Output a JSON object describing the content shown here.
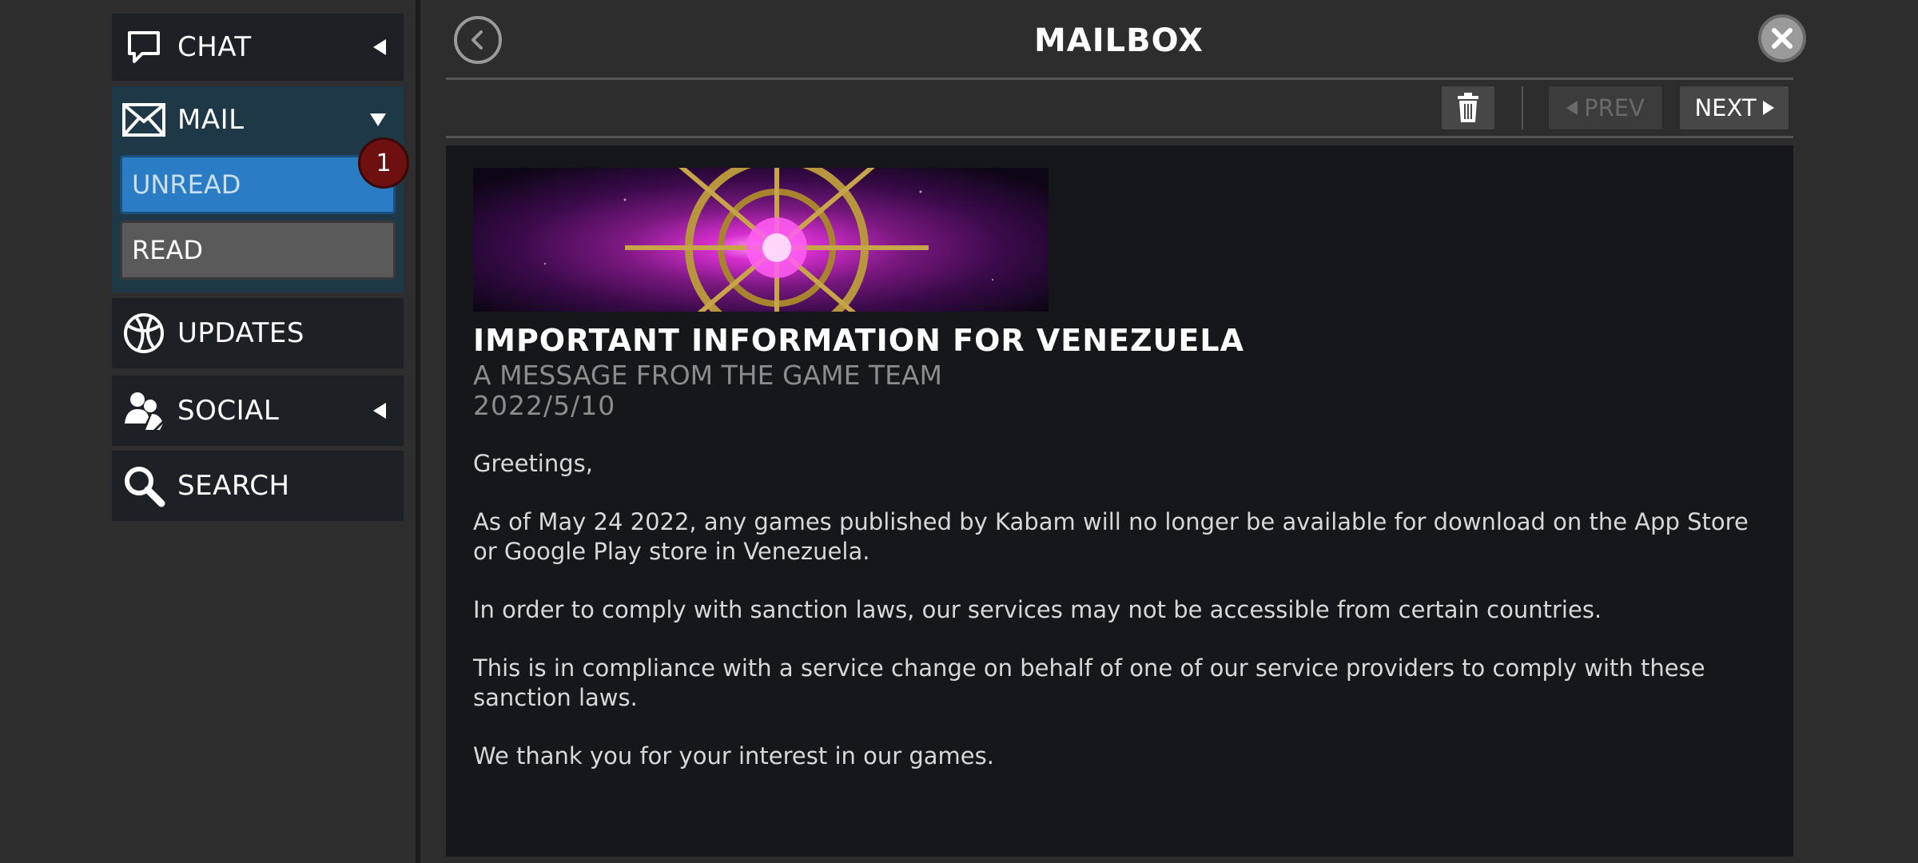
{
  "sidebar": {
    "chat_label": "CHAT",
    "mail_label": "MAIL",
    "unread_label": "UNREAD",
    "read_label": "READ",
    "unread_count": "1",
    "updates_label": "UPDATES",
    "social_label": "SOCIAL",
    "search_label": "SEARCH"
  },
  "header": {
    "title": "MAILBOX"
  },
  "toolbar": {
    "prev_label": "PREV",
    "next_label": "NEXT"
  },
  "message": {
    "title": "IMPORTANT INFORMATION FOR VENEZUELA",
    "subtitle": "A MESSAGE FROM THE GAME TEAM",
    "date": "2022/5/10",
    "paragraphs": [
      "Greetings,",
      "As of May 24 2022, any games published by Kabam will no longer be available for download on the App Store or Google Play store in Venezuela.",
      "In order to comply with sanction laws, our services may not be accessible from certain countries.",
      "This is in compliance with a service change on behalf of one of our service providers to comply with these sanction laws.",
      "We thank you for your interest in our games."
    ]
  },
  "icons": {
    "chat": "chat-bubble-icon",
    "mail": "envelope-icon",
    "updates": "globe-icon",
    "social": "people-icon",
    "search": "magnifier-icon",
    "back": "chevron-left-icon",
    "close": "close-icon",
    "trash": "trash-icon"
  },
  "colors": {
    "unread_accent": "#2a7cc4",
    "badge": "#6e0f10",
    "mail_group_bg": "#1f3848",
    "pane_bg": "#15171b"
  }
}
